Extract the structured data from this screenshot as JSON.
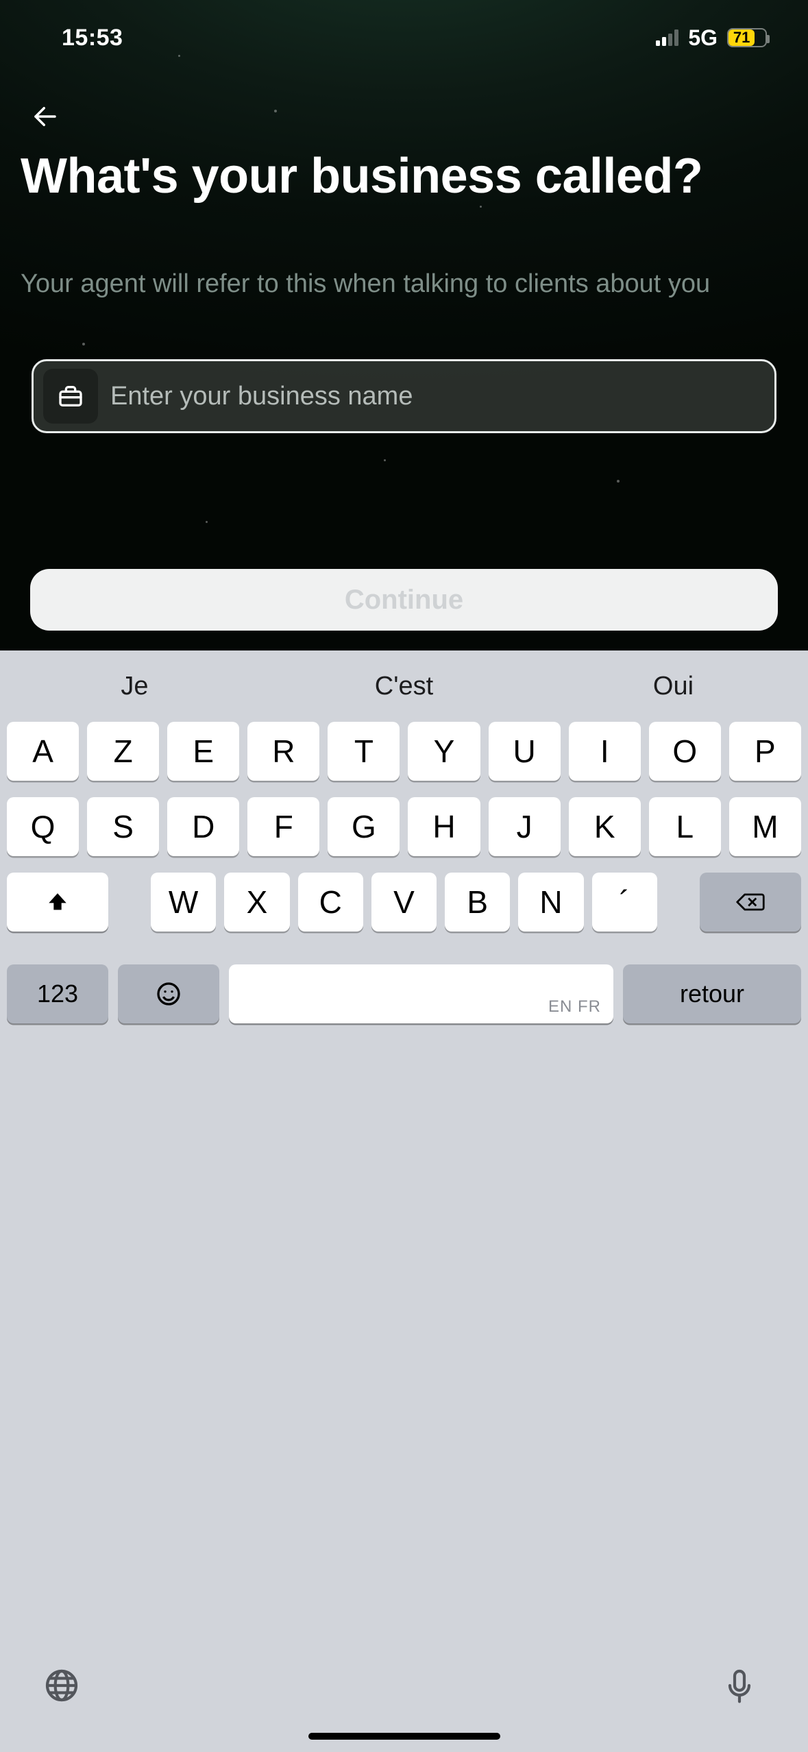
{
  "status": {
    "time": "15:53",
    "network": "5G",
    "battery_pct": 71
  },
  "screen": {
    "title": "What's your business called?",
    "subtitle": "Your agent will refer to this when talking to clients about you",
    "input": {
      "placeholder": "Enter your business name",
      "value": ""
    },
    "continue_label": "Continue"
  },
  "keyboard": {
    "suggestions": [
      "Je",
      "C'est",
      "Oui"
    ],
    "row1": [
      "A",
      "Z",
      "E",
      "R",
      "T",
      "Y",
      "U",
      "I",
      "O",
      "P"
    ],
    "row2": [
      "Q",
      "S",
      "D",
      "F",
      "G",
      "H",
      "J",
      "K",
      "L",
      "M"
    ],
    "row3": [
      "W",
      "X",
      "C",
      "V",
      "B",
      "N",
      "´"
    ],
    "numbers_label": "123",
    "space_lang": "EN FR",
    "return_label": "retour"
  }
}
